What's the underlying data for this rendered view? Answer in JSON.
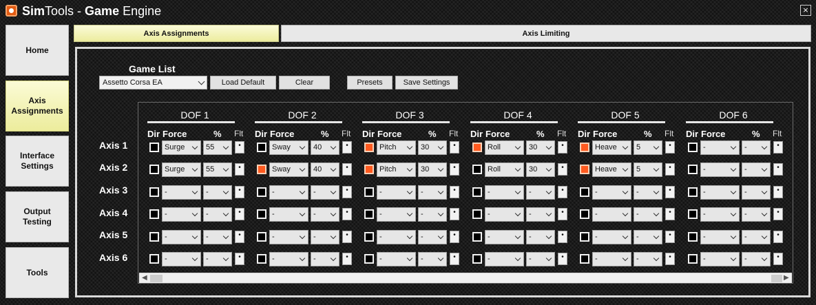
{
  "window": {
    "title_part1": "Sim",
    "title_part2": "Tools",
    "title_part3": " - ",
    "title_part4": "Game",
    "title_part5": " Engine",
    "close_label": "×"
  },
  "sidebar": {
    "items": [
      {
        "label": "Home",
        "active": false
      },
      {
        "label": "Axis Assignments",
        "active": true
      },
      {
        "label": "Interface Settings",
        "active": false
      },
      {
        "label": "Output Testing",
        "active": false
      },
      {
        "label": "Tools",
        "active": false
      }
    ]
  },
  "tabs": [
    {
      "label": "Axis Assignments",
      "active": true
    },
    {
      "label": "Axis Limiting",
      "active": false
    }
  ],
  "game_list": {
    "label": "Game List",
    "selected": "Assetto Corsa EA",
    "buttons": {
      "load_default": "Load Default",
      "clear": "Clear",
      "presets": "Presets",
      "save_settings": "Save Settings"
    }
  },
  "grid": {
    "column_headers": {
      "dir": "Dir",
      "force": "Force",
      "percent": "%",
      "flt": "Flt"
    },
    "dofs": [
      "DOF 1",
      "DOF 2",
      "DOF 3",
      "DOF 4",
      "DOF 5",
      "DOF 6"
    ],
    "axes": [
      {
        "label": "Axis 1",
        "cells": [
          {
            "dir": false,
            "force": "Surge",
            "percent": "55"
          },
          {
            "dir": false,
            "force": "Sway",
            "percent": "40"
          },
          {
            "dir": true,
            "force": "Pitch",
            "percent": "30"
          },
          {
            "dir": true,
            "force": "Roll",
            "percent": "30"
          },
          {
            "dir": true,
            "force": "Heave",
            "percent": "5"
          },
          {
            "dir": false,
            "force": "-",
            "percent": "-"
          }
        ]
      },
      {
        "label": "Axis 2",
        "cells": [
          {
            "dir": false,
            "force": "Surge",
            "percent": "55"
          },
          {
            "dir": true,
            "force": "Sway",
            "percent": "40"
          },
          {
            "dir": true,
            "force": "Pitch",
            "percent": "30"
          },
          {
            "dir": false,
            "force": "Roll",
            "percent": "30"
          },
          {
            "dir": true,
            "force": "Heave",
            "percent": "5"
          },
          {
            "dir": false,
            "force": "-",
            "percent": "-"
          }
        ]
      },
      {
        "label": "Axis 3",
        "cells": [
          {
            "dir": false,
            "force": "-",
            "percent": "-"
          },
          {
            "dir": false,
            "force": "-",
            "percent": "-"
          },
          {
            "dir": false,
            "force": "-",
            "percent": "-"
          },
          {
            "dir": false,
            "force": "-",
            "percent": "-"
          },
          {
            "dir": false,
            "force": "-",
            "percent": "-"
          },
          {
            "dir": false,
            "force": "-",
            "percent": "-"
          }
        ]
      },
      {
        "label": "Axis 4",
        "cells": [
          {
            "dir": false,
            "force": "-",
            "percent": "-"
          },
          {
            "dir": false,
            "force": "-",
            "percent": "-"
          },
          {
            "dir": false,
            "force": "-",
            "percent": "-"
          },
          {
            "dir": false,
            "force": "-",
            "percent": "-"
          },
          {
            "dir": false,
            "force": "-",
            "percent": "-"
          },
          {
            "dir": false,
            "force": "-",
            "percent": "-"
          }
        ]
      },
      {
        "label": "Axis 5",
        "cells": [
          {
            "dir": false,
            "force": "-",
            "percent": "-"
          },
          {
            "dir": false,
            "force": "-",
            "percent": "-"
          },
          {
            "dir": false,
            "force": "-",
            "percent": "-"
          },
          {
            "dir": false,
            "force": "-",
            "percent": "-"
          },
          {
            "dir": false,
            "force": "-",
            "percent": "-"
          },
          {
            "dir": false,
            "force": "-",
            "percent": "-"
          }
        ]
      },
      {
        "label": "Axis 6",
        "cells": [
          {
            "dir": false,
            "force": "-",
            "percent": "-"
          },
          {
            "dir": false,
            "force": "-",
            "percent": "-"
          },
          {
            "dir": false,
            "force": "-",
            "percent": "-"
          },
          {
            "dir": false,
            "force": "-",
            "percent": "-"
          },
          {
            "dir": false,
            "force": "-",
            "percent": "-"
          },
          {
            "dir": false,
            "force": "-",
            "percent": "-"
          }
        ]
      }
    ]
  },
  "colors": {
    "dir_active": "#ff5a1f",
    "tab_active": "#ecec9e"
  }
}
